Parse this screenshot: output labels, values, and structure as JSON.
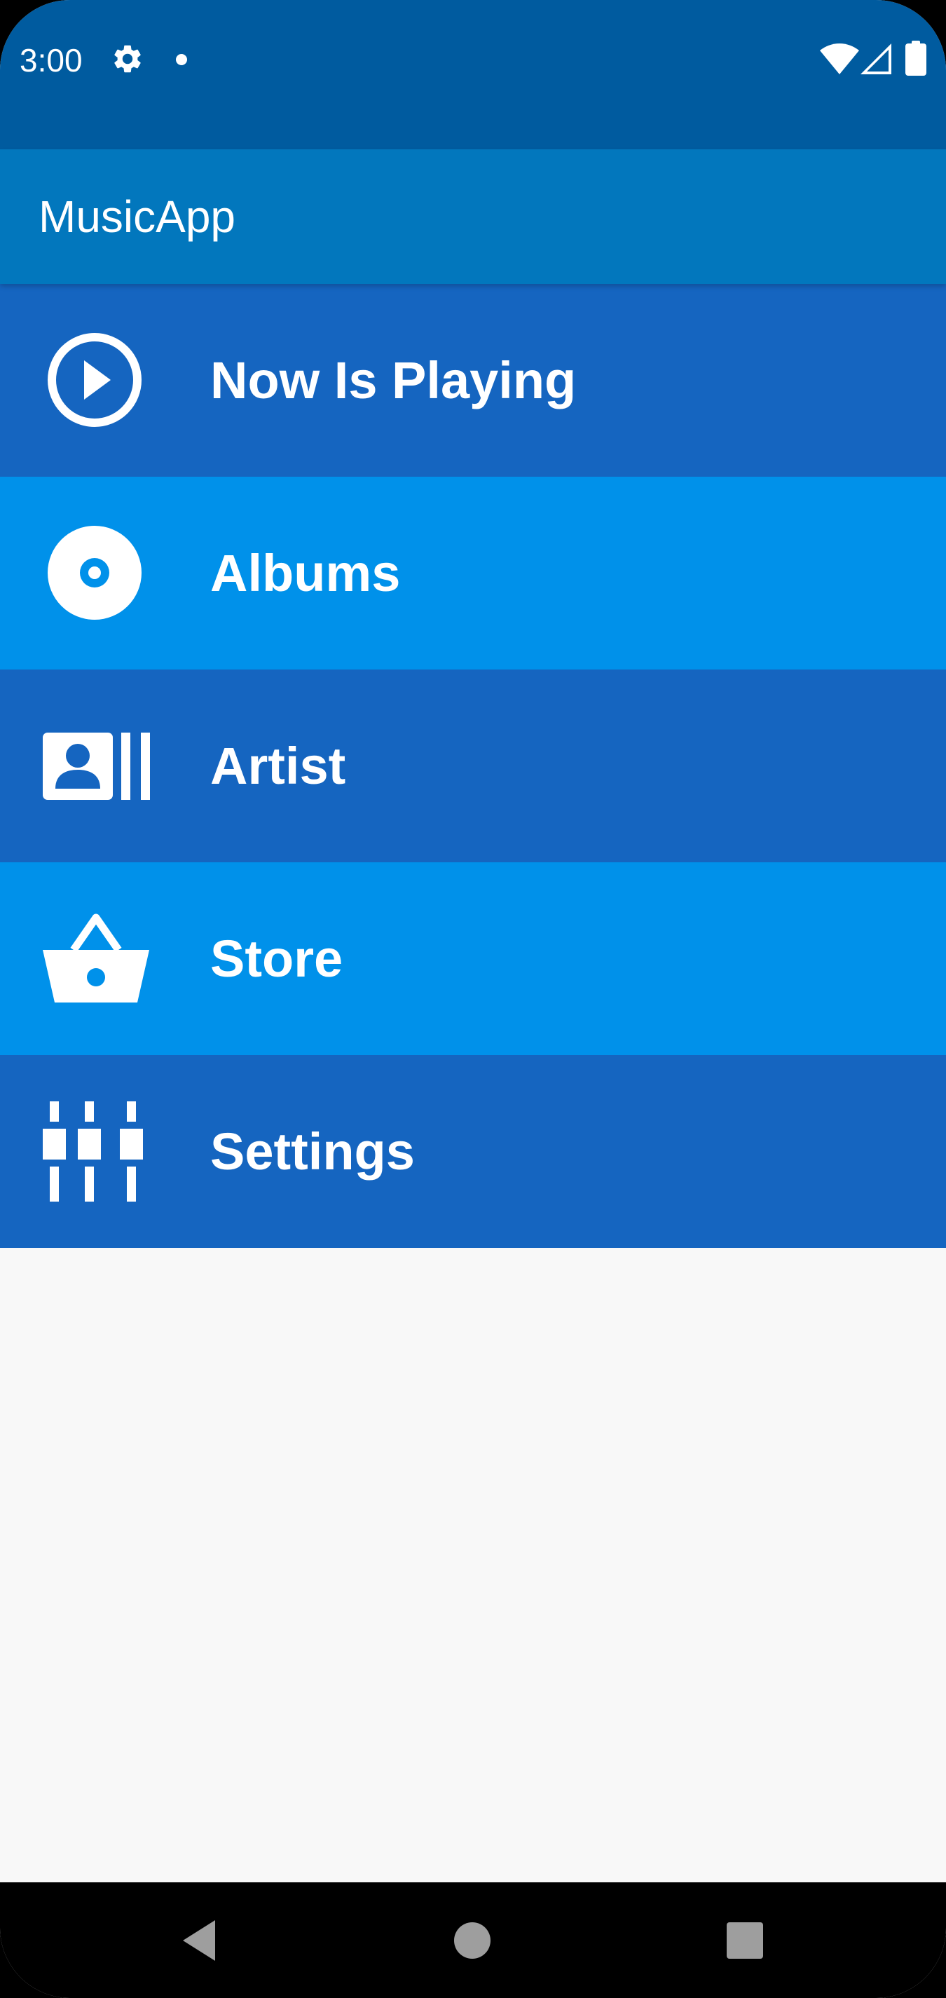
{
  "status_bar": {
    "time": "3:00",
    "icons": [
      "gear-icon",
      "notification-dot-icon",
      "wifi-icon",
      "cell-signal-icon",
      "battery-icon"
    ]
  },
  "app_bar": {
    "title": "MusicApp"
  },
  "menu": {
    "items": [
      {
        "label": "Now Is Playing",
        "icon": "play-circle-icon"
      },
      {
        "label": "Albums",
        "icon": "disc-icon"
      },
      {
        "label": "Artist",
        "icon": "artist-profile-icon"
      },
      {
        "label": "Store",
        "icon": "shopping-basket-icon"
      },
      {
        "label": "Settings",
        "icon": "equalizer-sliders-icon"
      }
    ]
  },
  "colors": {
    "status_bar": "#005b9f",
    "app_bar": "#0277bd",
    "item_dark": "#1565c0",
    "item_light": "#0091ea",
    "background": "#f8f8f8",
    "nav_bar": "#000000"
  },
  "nav_bar": {
    "buttons": [
      "back-icon",
      "home-icon",
      "recents-icon"
    ]
  }
}
